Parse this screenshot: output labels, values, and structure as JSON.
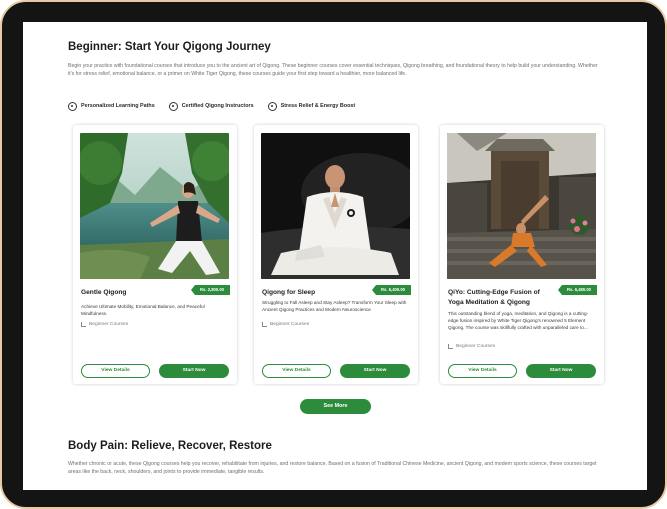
{
  "beginner": {
    "title": "Beginner: Start Your Qigong Journey",
    "description": "Begin your practice with foundational courses that introduce you to the ancient art of Qigong. These beginner courses cover essential techniques, Qigong breathing, and foundational theory to help build your understanding. Whether it's for stress relief, emotional balance, or a primer on White Tiger Qigong, these courses guide your first step toward a healthier, more balanced life.",
    "features": [
      {
        "label": "Personalized Learning Paths",
        "icon": "target-icon"
      },
      {
        "label": "Certified Qigong Instructors",
        "icon": "badge-icon"
      },
      {
        "label": "Stress Relief & Energy Boost",
        "icon": "energy-icon"
      }
    ]
  },
  "cards": [
    {
      "name": "Gentle Qigong",
      "price": "Rs. 2,800.00",
      "description": "Achieve Ultimate Mobility, Emotional Balance, and Peaceful Mindfulness.",
      "category": "Beginner Courses",
      "view_label": "View Details",
      "start_label": "Start Now"
    },
    {
      "name": "Qigong for Sleep",
      "price": "Rs. 5,400.00",
      "description": "Struggling to Fall Asleep and Stay Asleep? Transform Your Sleep with Ancient Qigong Practices and Modern Neuroscience",
      "category": "Beginner Courses",
      "view_label": "View Details",
      "start_label": "Start Now"
    },
    {
      "name": "QiYo: Cutting-Edge Fusion of Yoga Meditation & Qigong",
      "price": "Rs. 6,480.00",
      "description": "This outstanding blend of yoga, meditation, and Qigong is a cutting-edge fusion inspired by White Tiger Qigong's renowned 5 Element Qigong. The course was skillfully crafted with unparalleled care to...",
      "category": "Beginner Courses",
      "view_label": "View Details",
      "start_label": "Start Now"
    }
  ],
  "see_more_label": "See More",
  "body_pain": {
    "title": "Body Pain: Relieve, Recover, Restore",
    "description": "Whether chronic or acute, these Qigong courses help you recover, rehabilitate from injuries, and restore balance. Based on a fusion of Traditional Chinese Medicine, ancient Qigong, and modern sports science, these courses target areas like the back, neck, shoulders, and joints to provide immediate, tangible results."
  },
  "colors": {
    "accent": "#2c8c3c",
    "frame": "#141414",
    "frame_border": "#e8c9a4"
  }
}
